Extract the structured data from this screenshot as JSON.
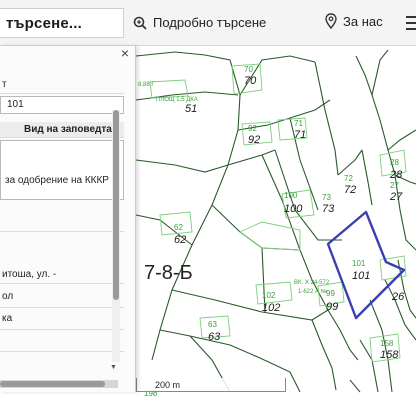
{
  "topbar": {
    "search_text": "търсене...",
    "advanced_search_label": "Подробно търсене",
    "about_label": "За нас"
  },
  "panel": {
    "close_glyph": "×",
    "rows": [
      "т",
      "101",
      "Вид на заповедта",
      "за одобрение на КККР",
      "",
      "итоша, ул. -",
      "ол",
      "ка"
    ]
  },
  "map": {
    "sheet_label": "7-8-Б",
    "scale_label": "200 m",
    "area_label": "ПЛОЩ 1,5 ДКА",
    "small_labels": [
      "8,88 Г",
      "ВК. Х 24-572",
      "1-622 А №"
    ],
    "parcels": [
      {
        "green": "70",
        "black": "70"
      },
      {
        "green": "",
        "black": "51"
      },
      {
        "green": "92",
        "black": "92"
      },
      {
        "green": "71",
        "black": "71"
      },
      {
        "green": "72",
        "black": "72"
      },
      {
        "green": "28",
        "black": "28"
      },
      {
        "green": "27",
        "black": "27"
      },
      {
        "green": "100",
        "black": "100"
      },
      {
        "green": "73",
        "black": "73"
      },
      {
        "green": "62",
        "black": "62"
      },
      {
        "green": "101",
        "black": "101"
      },
      {
        "green": "102",
        "black": "102"
      },
      {
        "green": "99",
        "black": "99"
      },
      {
        "green": "",
        "black": "26"
      },
      {
        "green": "63",
        "black": "63"
      },
      {
        "green": "158",
        "black": "158"
      },
      {
        "green": "198",
        "black": ""
      }
    ]
  },
  "colors": {
    "parcel_line": "#2a5a2a",
    "label_green": "#3ca03c",
    "highlight": "#3b3fae"
  }
}
